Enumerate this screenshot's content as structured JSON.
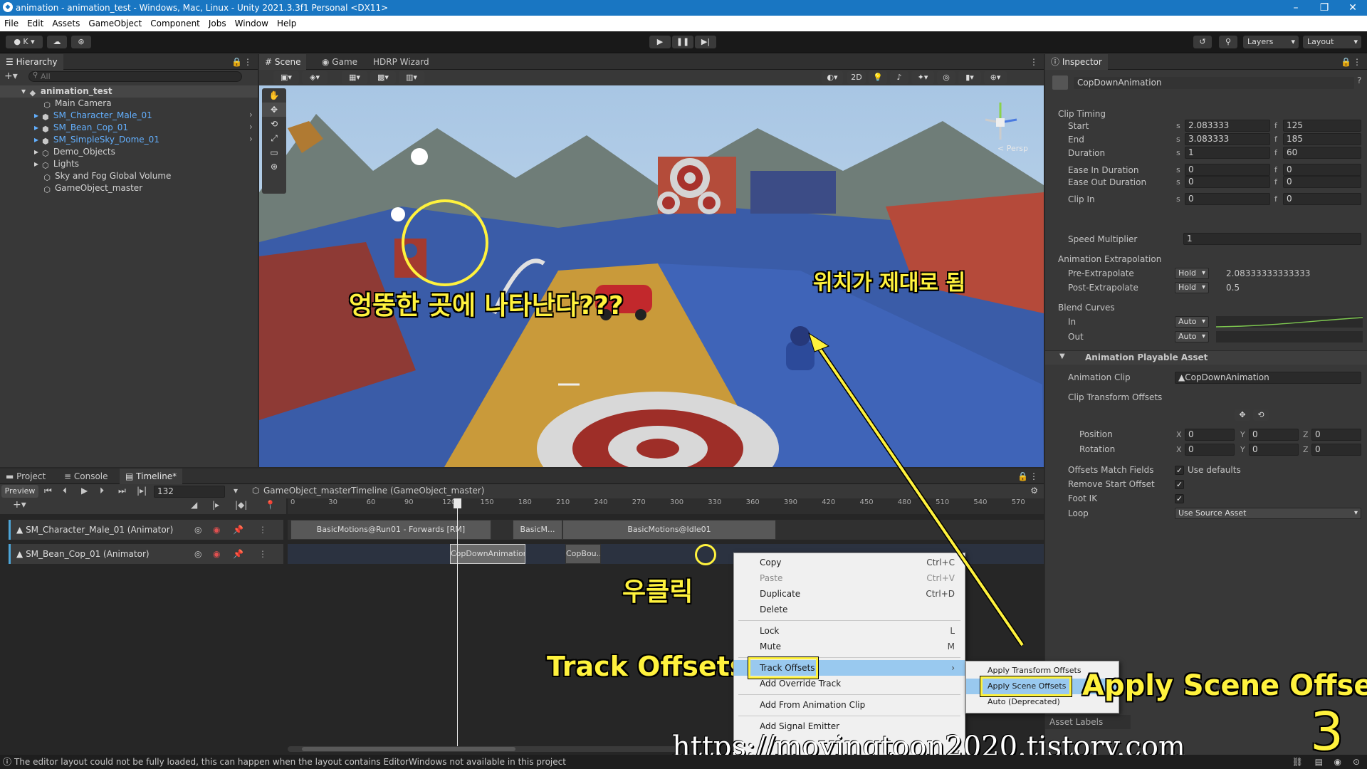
{
  "window": {
    "title": "animation - animation_test - Windows, Mac, Linux - Unity 2021.3.3f1 Personal <DX11>",
    "app_icon": "unity-icon"
  },
  "menu": [
    "File",
    "Edit",
    "Assets",
    "GameObject",
    "Component",
    "Jobs",
    "Window",
    "Help"
  ],
  "toolbar": {
    "account": "K",
    "layers_label": "Layers",
    "layout_label": "Layout"
  },
  "hierarchy": {
    "tab": "Hierarchy",
    "search_placeholder": "All",
    "scene": "animation_test",
    "items": [
      {
        "label": "Main Camera",
        "blue": false
      },
      {
        "label": "SM_Character_Male_01",
        "blue": true
      },
      {
        "label": "SM_Bean_Cop_01",
        "blue": true
      },
      {
        "label": "SM_SimpleSky_Dome_01",
        "blue": true
      },
      {
        "label": "Demo_Objects",
        "blue": false
      },
      {
        "label": "Lights",
        "blue": false
      },
      {
        "label": "Sky and Fog Global Volume",
        "blue": false
      },
      {
        "label": "GameObject_master",
        "blue": false
      }
    ]
  },
  "scene_view": {
    "tabs": [
      "Scene",
      "Game",
      "HDRP Wizard"
    ],
    "btn_2d": "2D",
    "persp_label": "< Persp",
    "annotation_wrong": "엉뚱한 곳에 나타난다???",
    "annotation_right": "위치가 제대로 됨"
  },
  "inspector": {
    "tab": "Inspector",
    "object_name": "CopDownAnimation",
    "clip_timing": "Clip Timing",
    "rows": [
      {
        "label": "Start",
        "s": "2.083333",
        "f": "125"
      },
      {
        "label": "End",
        "s": "3.083333",
        "f": "185"
      },
      {
        "label": "Duration",
        "s": "1",
        "f": "60"
      },
      {
        "label": "Ease In Duration",
        "s": "0",
        "f": "0"
      },
      {
        "label": "Ease Out Duration",
        "s": "0",
        "f": "0"
      },
      {
        "label": "Clip In",
        "s": "0",
        "f": "0"
      }
    ],
    "unit_s": "s",
    "unit_f": "f",
    "speed_label": "Speed Multiplier",
    "speed_value": "1",
    "extrapolation_title": "Animation Extrapolation",
    "pre_label": "Pre-Extrapolate",
    "pre_mode": "Hold",
    "pre_value": "2.08333333333333",
    "post_label": "Post-Extrapolate",
    "post_mode": "Hold",
    "post_value": "0.5",
    "blend_title": "Blend Curves",
    "blend_in_label": "In",
    "blend_in_mode": "Auto",
    "blend_out_label": "Out",
    "blend_out_mode": "Auto",
    "playable_title": "Animation Playable Asset",
    "anim_clip_label": "Animation Clip",
    "anim_clip_value": "CopDownAnimation",
    "clip_offsets_title": "Clip Transform Offsets",
    "position_label": "Position",
    "rotation_label": "Rotation",
    "axis_x": "X",
    "axis_y": "Y",
    "axis_z": "Z",
    "pos": [
      "0",
      "0",
      "0"
    ],
    "rot": [
      "0",
      "0",
      "0"
    ],
    "offsets_match_label": "Offsets Match Fields",
    "use_defaults": "Use defaults",
    "remove_start_label": "Remove Start Offset",
    "foot_ik_label": "Foot IK",
    "loop_label": "Loop",
    "loop_value": "Use Source Asset",
    "asset_labels": "Asset Labels"
  },
  "bottom": {
    "tabs": [
      "Project",
      "Console",
      "Timeline*"
    ],
    "preview": "Preview",
    "frame": "132",
    "timeline_asset": "GameObject_masterTimeline (GameObject_master)",
    "ruler": [
      "0",
      "30",
      "60",
      "90",
      "120",
      "150",
      "180",
      "210",
      "240",
      "270",
      "300",
      "330",
      "360",
      "390",
      "420",
      "450",
      "480",
      "510",
      "540",
      "570"
    ],
    "tracks": [
      {
        "label": "SM_Character_Male_01 (Animator)"
      },
      {
        "label": "SM_Bean_Cop_01 (Animator)"
      }
    ],
    "clips_track1": [
      "BasicMotions@Run01 - Forwards [RM]",
      "BasicM...",
      "BasicMotions@Idle01"
    ],
    "clips_track2": [
      "CopDownAnimation",
      "CopBou..."
    ],
    "annotation_rightclick": "우클릭",
    "annotation_track_offsets": "Track Offsets",
    "annotation_apply": "Apply Scene Offsets",
    "annotation_step": "3"
  },
  "context_menu": {
    "items": [
      {
        "label": "Copy",
        "shortcut": "Ctrl+C",
        "enabled": true
      },
      {
        "label": "Paste",
        "shortcut": "Ctrl+V",
        "enabled": false
      },
      {
        "label": "Duplicate",
        "shortcut": "Ctrl+D",
        "enabled": true
      },
      {
        "label": "Delete",
        "shortcut": "",
        "enabled": true
      },
      {
        "label": "Lock",
        "shortcut": "L",
        "enabled": true
      },
      {
        "label": "Mute",
        "shortcut": "M",
        "enabled": true
      },
      {
        "label": "Track Offsets",
        "shortcut": "",
        "enabled": true
      },
      {
        "label": "Add Override Track",
        "shortcut": "",
        "enabled": true
      },
      {
        "label": "Add From Animation Clip",
        "shortcut": "",
        "enabled": true
      },
      {
        "label": "Add Signal Emitter",
        "shortcut": "",
        "enabled": true
      }
    ],
    "submenu": [
      "Apply Transform Offsets",
      "Apply Scene Offsets",
      "Auto (Deprecated)"
    ]
  },
  "status": {
    "message": "The editor layout could not be fully loaded, this can happen when the layout contains EditorWindows not available in this project"
  },
  "watermark": "https://movingtoon2020.tistory.com",
  "colors": {
    "title_bar": "#1976c2",
    "annotation_yellow": "#fff23d",
    "selection_blue": "#99c9ef"
  }
}
